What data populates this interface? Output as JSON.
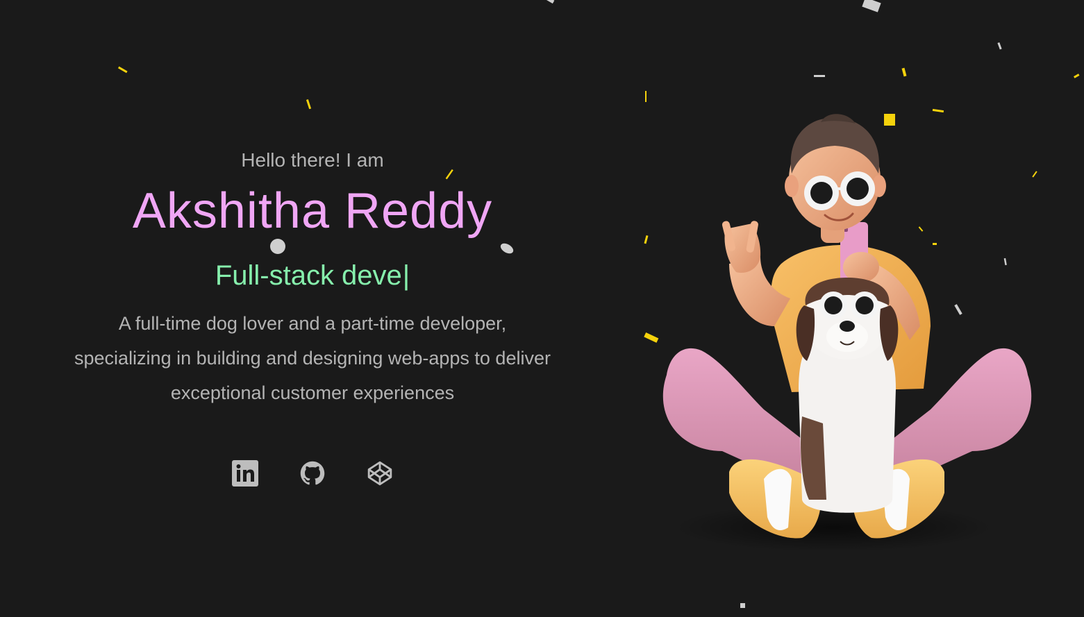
{
  "hero": {
    "greeting": "Hello there! I am",
    "name": "Akshitha Reddy",
    "role_typed": "Full-stack deve",
    "caret": "|",
    "bio_lines": [
      "A full-time dog lover and a part-time developer,",
      "specializing in building and designing web-apps to deliver",
      "exceptional customer experiences"
    ]
  },
  "social_links": [
    {
      "icon": "linkedin-icon",
      "label": "in"
    },
    {
      "icon": "github-icon"
    },
    {
      "icon": "codepen-icon"
    }
  ],
  "colors": {
    "background": "#1a1a1a",
    "name": "#f0a6f5",
    "role": "#86efac",
    "text": "#b4b4b4",
    "confetti_gold": "#f5d20c",
    "confetti_silver": "#cfcfcf"
  },
  "illustration": {
    "icon": "developer-with-dog-illustration"
  }
}
